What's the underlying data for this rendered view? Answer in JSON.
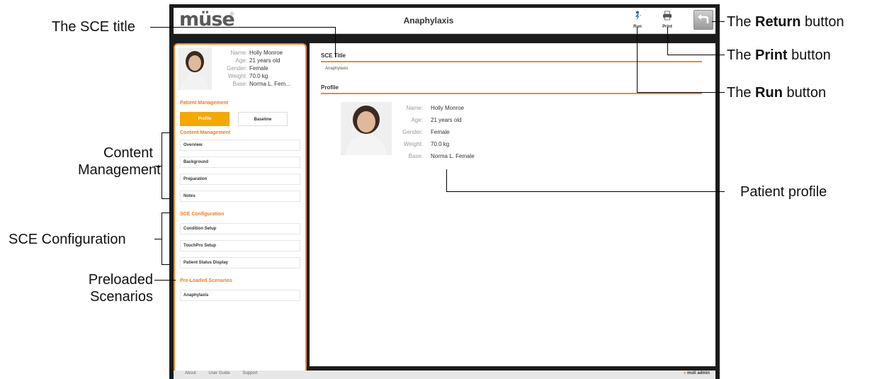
{
  "app": {
    "logo": "müse",
    "logo_mark": "®",
    "window_title": "Anaphylaxis"
  },
  "toolbar": {
    "run_label": "Run",
    "print_label": "Print"
  },
  "sidebar": {
    "patient": {
      "name_label": "Name:",
      "name": "Holly Monroe",
      "age_label": "Age:",
      "age": "21 years old",
      "gender_label": "Gender:",
      "gender": "Female",
      "weight_label": "Weight:",
      "weight": "70.0 kg",
      "base_label": "Base:",
      "base": "Norma L. Fem..."
    },
    "patient_management": {
      "heading": "Patient Management",
      "tab_profile": "Profile",
      "tab_baseline": "Baseline"
    },
    "content_management": {
      "heading": "Content Management",
      "items": [
        "Overview",
        "Background",
        "Preparation",
        "Notes"
      ]
    },
    "sce_configuration": {
      "heading": "SCE Configuration",
      "items": [
        "Condition Setup",
        "TouchPro Setup",
        "Patient Status Display"
      ]
    },
    "preloaded": {
      "heading": "Pre-Loaded Scenarios",
      "items": [
        "Anaphylaxis"
      ]
    }
  },
  "main": {
    "sce_title_heading": "SCE Title",
    "sce_title_value": "Anaphylaxis",
    "profile_heading": "Profile",
    "profile": {
      "name_label": "Name:",
      "name": "Holly Monroe",
      "age_label": "Age:",
      "age": "21 years old",
      "gender_label": "Gender:",
      "gender": "Female",
      "weight_label": "Weight:",
      "weight": "70.0 kg",
      "base_label": "Base:",
      "base": "Norma L. Female"
    }
  },
  "footer": {
    "about": "About",
    "user_guide": "User Guide",
    "support": "Support",
    "user": "muti admin"
  },
  "callouts": {
    "sce_title": "The SCE title",
    "content_management": [
      "Content",
      "Management"
    ],
    "sce_configuration": "SCE Configuration",
    "preloaded": [
      "Preloaded",
      "Scenarios"
    ],
    "return": {
      "pre": "The ",
      "bold": "Return",
      "post": " button"
    },
    "print": {
      "pre": "The ",
      "bold": "Print",
      "post": " button"
    },
    "run": {
      "pre": "The ",
      "bold": "Run",
      "post": " button"
    },
    "patient_profile": "Patient profile"
  },
  "colors": {
    "accent": "#f08a2e",
    "active_tab": "#f6a800",
    "frame": "#1c1c1c"
  }
}
